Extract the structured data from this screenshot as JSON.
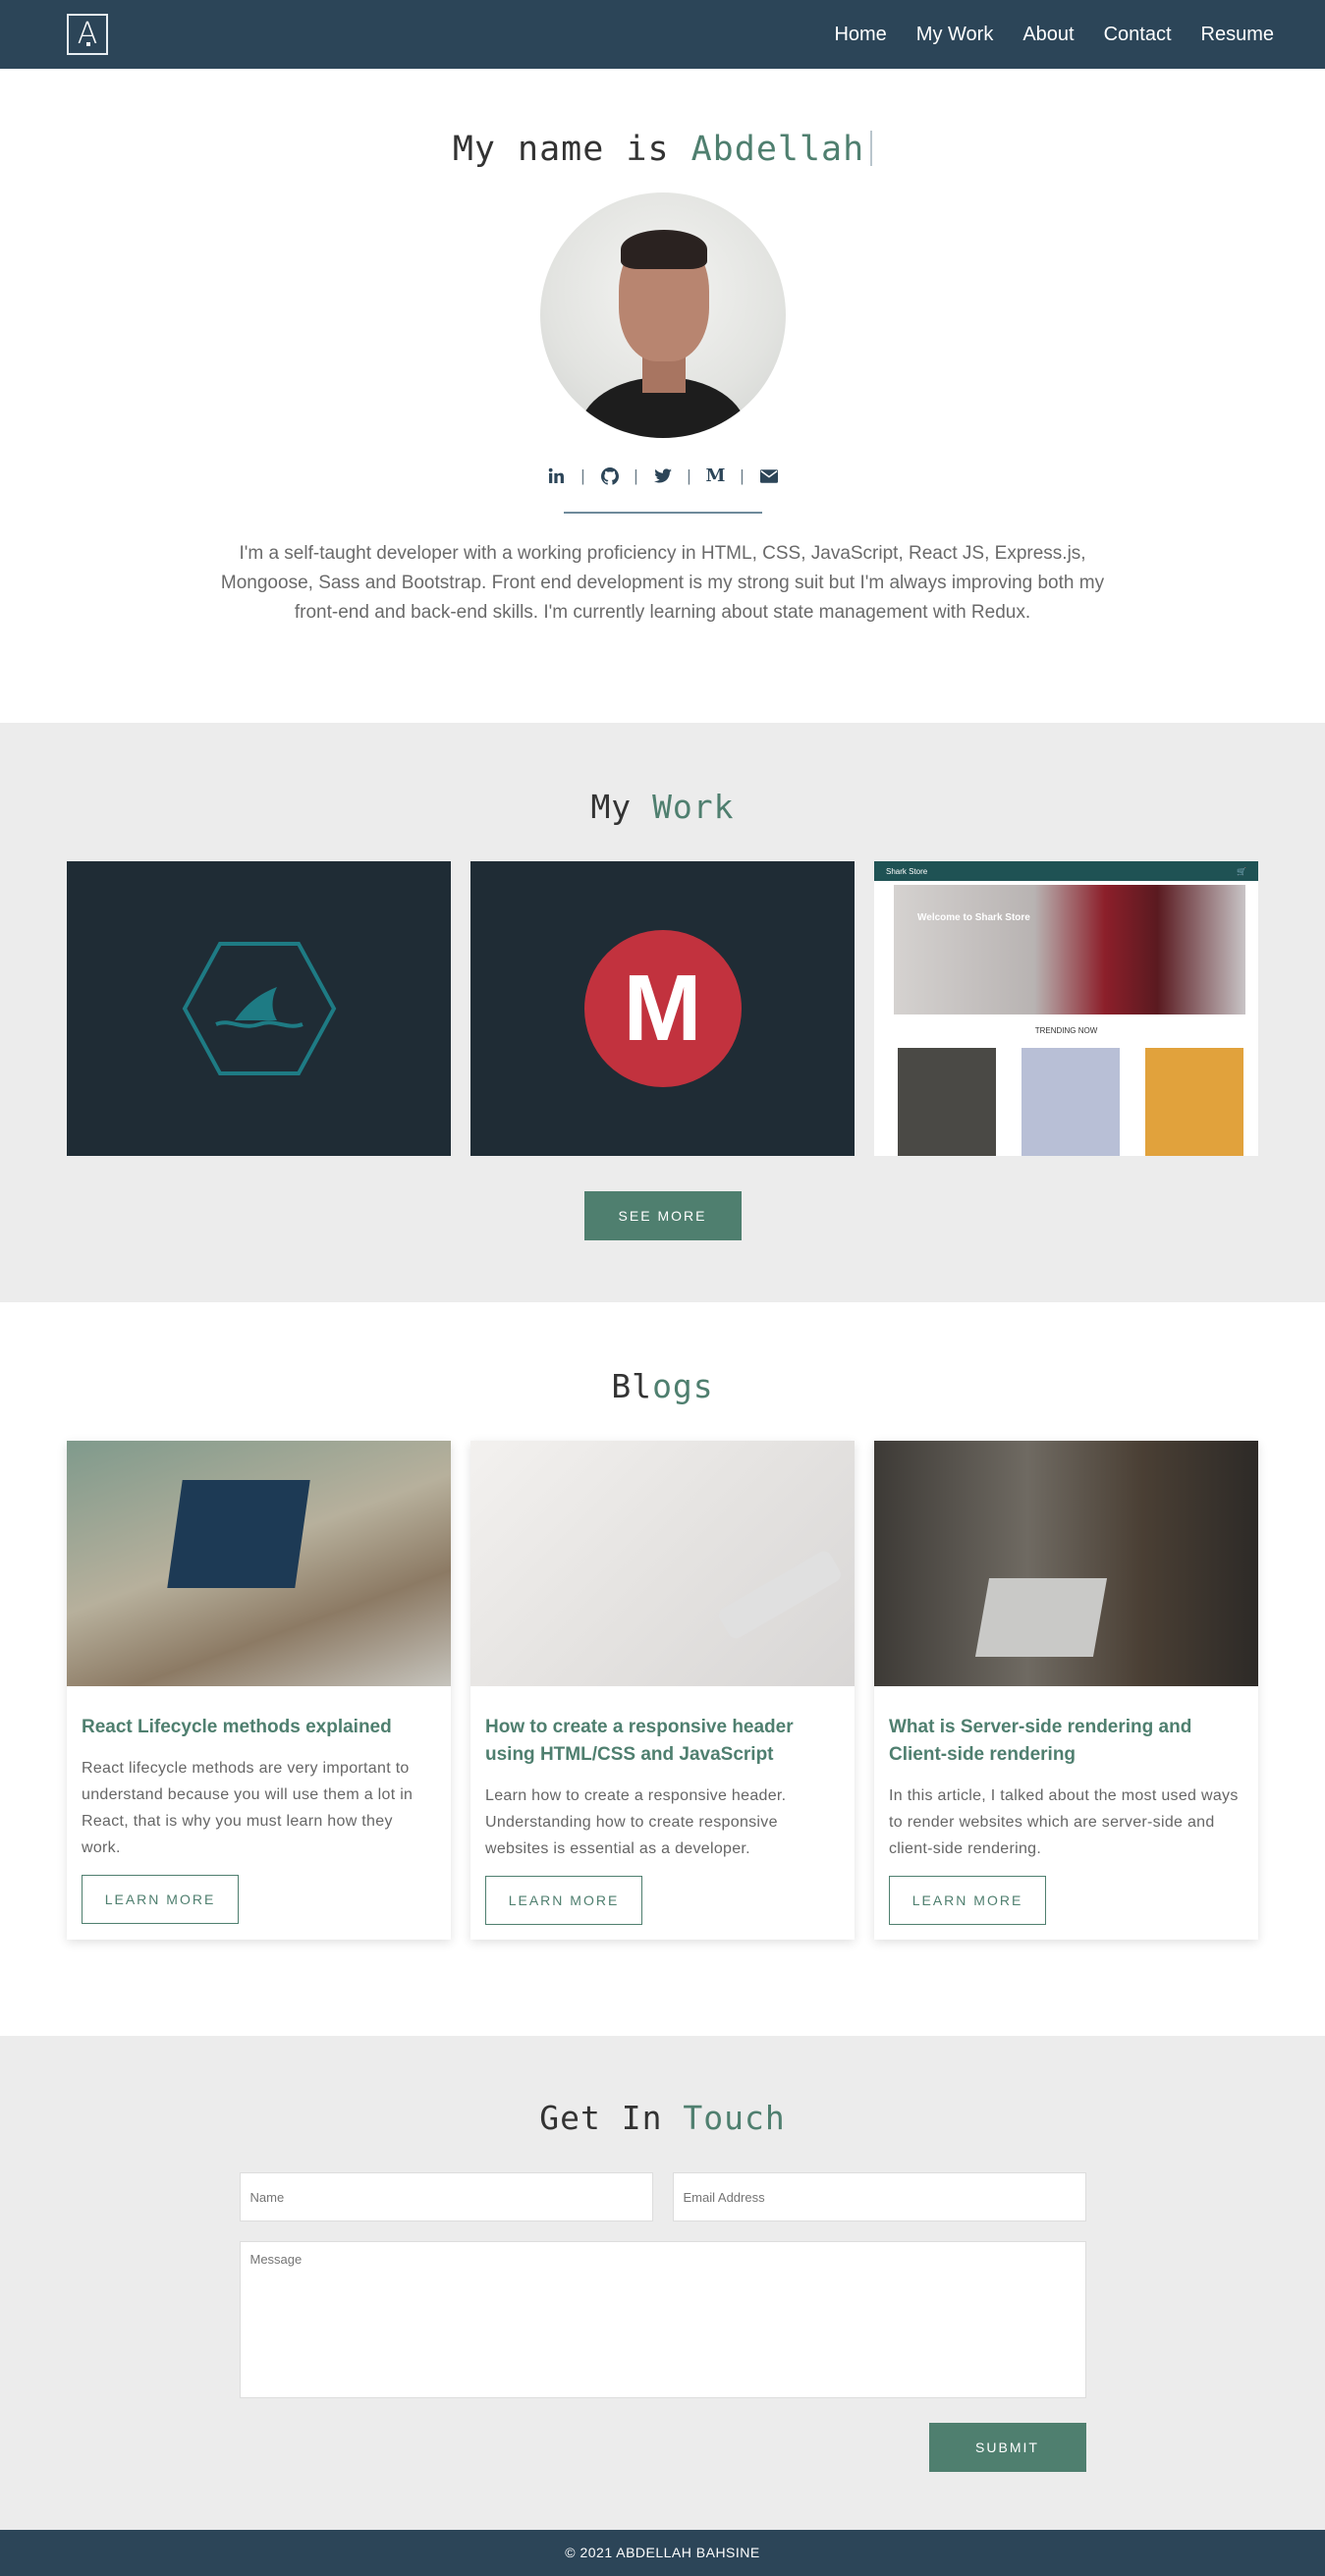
{
  "nav": {
    "logo": "A",
    "links": [
      "Home",
      "My Work",
      "About",
      "Contact",
      "Resume"
    ]
  },
  "hero": {
    "heading_prefix": "My name is",
    "heading_name": "Abdellah",
    "socials": [
      "linkedin-icon",
      "github-icon",
      "twitter-icon",
      "medium-icon",
      "envelope-icon"
    ],
    "medium_glyph": "M",
    "about": "I'm a self-taught developer with a working proficiency in HTML, CSS, JavaScript, React JS, Express.js, Mongoose, Sass and Bootstrap. Front end development is my strong suit but I'm always improving both my front-end and back-end skills. I'm currently learning about state management with Redux."
  },
  "work": {
    "title_a": "My",
    "title_b": "Work",
    "card2_letter": "M",
    "store_brand": "Shark Store",
    "store_welcome": "Welcome to Shark Store",
    "store_trending": "TRENDING NOW",
    "see_more": "SEE MORE"
  },
  "blogs": {
    "title_a": "Bl",
    "title_b": "ogs",
    "items": [
      {
        "title": "React Lifecycle methods explained",
        "text": "React lifecycle methods are very important to understand because you will use them a lot in React, that is why you must learn how they work.",
        "button": "LEARN MORE"
      },
      {
        "title": "How to create a responsive header using HTML/CSS and JavaScript",
        "text": "Learn how to create a responsive header. Understanding how to create responsive websites is essential as a developer.",
        "button": "LEARN MORE"
      },
      {
        "title": "What is Server-side rendering and Client-side rendering",
        "text": "In this article, I talked about the most used ways to render websites which are server-side and client-side rendering.",
        "button": "LEARN MORE"
      }
    ]
  },
  "contact": {
    "title_a": "Get In",
    "title_b": "Touch",
    "name_placeholder": "Name",
    "email_placeholder": "Email Address",
    "message_placeholder": "Message",
    "submit": "SUBMIT"
  },
  "footer": {
    "text": "© 2021 ABDELLAH BAHSINE"
  },
  "colors": {
    "navy": "#2c4558",
    "accent_green": "#4f7f6f",
    "section_gray": "#ececec",
    "card_dark": "#1f2c35",
    "medium_red": "#c2323e"
  }
}
